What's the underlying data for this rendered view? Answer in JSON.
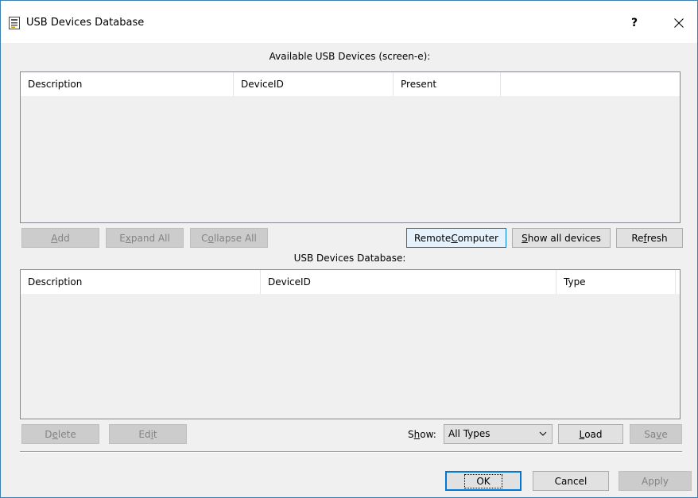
{
  "window": {
    "title": "USB Devices Database",
    "help_label": "?",
    "icons": {
      "app": "database-icon",
      "close": "close-icon",
      "dropdown": "chevron-down-icon"
    }
  },
  "available": {
    "caption": "Available USB Devices (screen-e):",
    "columns": [
      "Description",
      "DeviceID",
      "Present"
    ],
    "buttons": {
      "add": {
        "pre": "",
        "u": "A",
        "post": "dd"
      },
      "expand_all": {
        "pre": "E",
        "u": "x",
        "post": "pand All"
      },
      "collapse_all": {
        "pre": "C",
        "u": "o",
        "post": "llapse All"
      },
      "remote_computer": {
        "pre": "Remote ",
        "u": "C",
        "post": "omputer"
      },
      "show_all_devices": {
        "pre": "",
        "u": "S",
        "post": "how all devices"
      },
      "refresh": {
        "pre": "Re",
        "u": "f",
        "post": "resh"
      }
    }
  },
  "database": {
    "caption": "USB Devices Database:",
    "columns": [
      "Description",
      "DeviceID",
      "Type"
    ],
    "buttons": {
      "delete": {
        "pre": "D",
        "u": "e",
        "post": "lete"
      },
      "edit": {
        "pre": "Ed",
        "u": "i",
        "post": "t"
      },
      "load": {
        "pre": "",
        "u": "L",
        "post": "oad"
      },
      "save": {
        "pre": "Sa",
        "u": "v",
        "post": "e"
      }
    },
    "show_label": {
      "pre": "S",
      "u": "h",
      "post": "ow:"
    },
    "show_value": "All Types"
  },
  "footer": {
    "ok_label": "OK",
    "cancel_label": "Cancel",
    "apply_label": "Apply"
  }
}
